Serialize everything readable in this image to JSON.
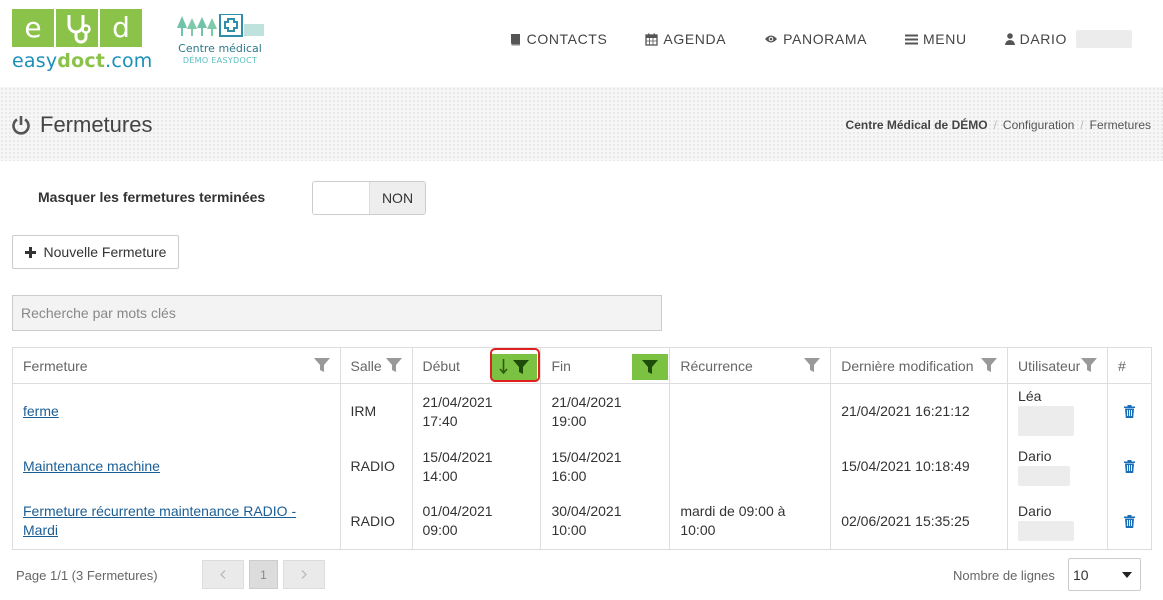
{
  "brand": {
    "tiles": [
      "e",
      "d"
    ],
    "logo_prefix": "easy",
    "logo_bold": "doct",
    "logo_suffix": ".com",
    "centre_line1": "Centre médical",
    "centre_line2": "DÉMO EASYDOCT"
  },
  "nav": {
    "contacts": "CONTACTS",
    "agenda": "AGENDA",
    "panorama": "PANORAMA",
    "menu": "MENU",
    "user": "DARIO"
  },
  "page": {
    "title": "Fermetures",
    "breadcrumb": [
      "Centre Médical de DÉMO",
      "Configuration",
      "Fermetures"
    ],
    "breadcrumb_sep": "/"
  },
  "controls": {
    "toggle_label": "Masquer les fermetures terminées",
    "toggle_value": "NON",
    "new_button": "Nouvelle Fermeture",
    "search_placeholder": "Recherche par mots clés"
  },
  "table": {
    "columns": [
      "Fermeture",
      "Salle",
      "Début",
      "Fin",
      "Récurrence",
      "Dernière modification",
      "Utilisateur",
      "#"
    ],
    "rows": [
      {
        "fermeture": "ferme",
        "salle": "IRM",
        "debut_date": "21/04/2021",
        "debut_time": "17:40",
        "fin_date": "21/04/2021",
        "fin_time": "19:00",
        "recurrence_l1": "",
        "recurrence_l2": "",
        "derniere_modif": "21/04/2021 16:21:12",
        "utilisateur": "Léa"
      },
      {
        "fermeture": "Maintenance machine",
        "salle": "RADIO",
        "debut_date": "15/04/2021",
        "debut_time": "14:00",
        "fin_date": "15/04/2021",
        "fin_time": "16:00",
        "recurrence_l1": "",
        "recurrence_l2": "",
        "derniere_modif": "15/04/2021 10:18:49",
        "utilisateur": "Dario"
      },
      {
        "fermeture_l1": "Fermeture récurrente maintenance RADIO -",
        "fermeture_l2": "Mardi",
        "salle": "RADIO",
        "debut_date": "01/04/2021",
        "debut_time": "09:00",
        "fin_date": "30/04/2021",
        "fin_time": "10:00",
        "recurrence_l1": "mardi de 09:00 à",
        "recurrence_l2": "10:00",
        "derniere_modif": "02/06/2021 15:35:25",
        "utilisateur": "Dario"
      }
    ]
  },
  "footer": {
    "page_info": "Page 1/1 (3 Fermetures)",
    "current_page": "1",
    "rows_label": "Nombre de lignes",
    "rows_value": "10"
  },
  "colors": {
    "brand_green": "#8bc34a",
    "brand_blue": "#1b8fb8",
    "filter_active": "#7cc242",
    "highlight_border": "#e02020",
    "link": "#1a5e96"
  },
  "icons": {
    "contacts": "book-icon",
    "agenda": "calendar-icon",
    "panorama": "eye-icon",
    "menu": "bars-icon",
    "user": "user-icon",
    "title": "power-icon",
    "filter": "filter-icon",
    "sort": "sort-down-arrow-icon",
    "delete": "trash-icon"
  }
}
